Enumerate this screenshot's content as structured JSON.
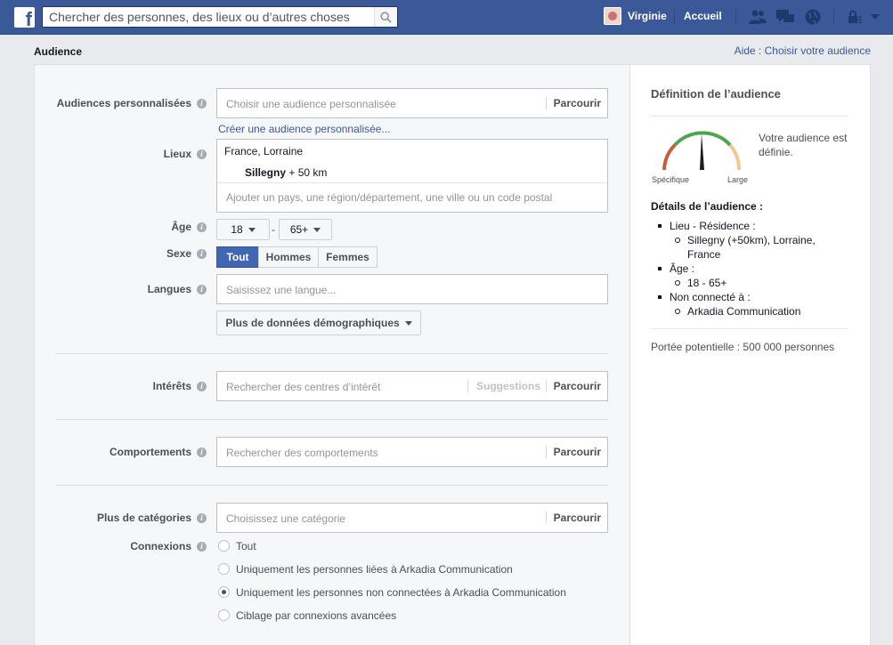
{
  "topbar": {
    "search_placeholder": "Chercher des personnes, des lieux ou d’autres choses",
    "user_name": "Virginie",
    "home": "Accueil"
  },
  "page": {
    "title": "Audience",
    "help_link": "Aide : Choisir votre audience"
  },
  "form": {
    "custom_audiences": {
      "label": "Audiences personnalisées",
      "placeholder": "Choisir une audience personnalisée",
      "browse": "Parcourir",
      "create_link": "Créer une audience personnalisée..."
    },
    "locations": {
      "label": "Lieux",
      "country": "France, Lorraine",
      "city": "Sillegny",
      "radius": "+ 50 km",
      "placeholder": "Ajouter un pays, une région/département, une ville ou un code postal"
    },
    "age": {
      "label": "Âge",
      "min": "18",
      "separator": "-",
      "max": "65+"
    },
    "gender": {
      "label": "Sexe",
      "options": [
        "Tout",
        "Hommes",
        "Femmes"
      ],
      "selected": "Tout"
    },
    "languages": {
      "label": "Langues",
      "placeholder": "Saisissez une langue..."
    },
    "more_demographics": "Plus de données démographiques",
    "interests": {
      "label": "Intérêts",
      "placeholder": "Rechercher des centres d’intérêt",
      "suggestions": "Suggestions",
      "browse": "Parcourir"
    },
    "behaviors": {
      "label": "Comportements",
      "placeholder": "Rechercher des comportements",
      "browse": "Parcourir"
    },
    "more_categories": {
      "label": "Plus de catégories",
      "placeholder": "Choisissez une catégorie",
      "browse": "Parcourir"
    },
    "connections": {
      "label": "Connexions",
      "options": [
        "Tout",
        "Uniquement les personnes liées à Arkadia Communication",
        "Uniquement les personnes non connectées à Arkadia Communication",
        "Ciblage par connexions avancées"
      ],
      "selected_index": 2
    }
  },
  "sidebar": {
    "title": "Définition de l’audience",
    "gauge_left": "Spécifique",
    "gauge_right": "Large",
    "definition": "Votre audience est définie.",
    "details_title": "Détails de l’audience :",
    "details": [
      {
        "label": "Lieu - Résidence :",
        "sub": "Sillegny (+50km), Lorraine, France"
      },
      {
        "label": "Âge :",
        "sub": "18 - 65+"
      },
      {
        "label": "Non connecté à :",
        "sub": "Arkadia Communication"
      }
    ],
    "reach": "Portée potentielle : 500 000 personnes"
  },
  "colors": {
    "topbar": "#3b5998",
    "accent": "#4267b2",
    "link": "#3b5998"
  }
}
